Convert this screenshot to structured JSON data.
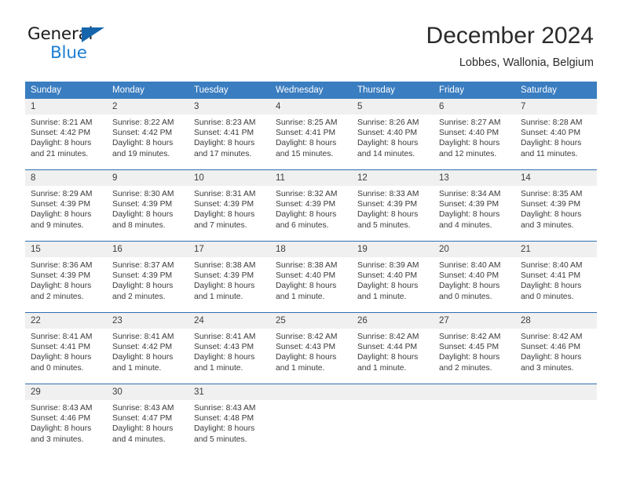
{
  "brand": {
    "name_part1": "General",
    "name_part2": "Blue",
    "triangle_color": "#1565ac",
    "blue_color": "#1b7fd4"
  },
  "header": {
    "title": "December 2024",
    "subtitle": "Lobbes, Wallonia, Belgium"
  },
  "theme": {
    "header_row_bg": "#3a7dc0",
    "daynum_bg": "#f0f0f0",
    "week_separator": "#2f6fb0"
  },
  "weekday_headers": [
    "Sunday",
    "Monday",
    "Tuesday",
    "Wednesday",
    "Thursday",
    "Friday",
    "Saturday"
  ],
  "weeks": [
    {
      "days": [
        {
          "num": "1",
          "sunrise": "Sunrise: 8:21 AM",
          "sunset": "Sunset: 4:42 PM",
          "daylight1": "Daylight: 8 hours",
          "daylight2": "and 21 minutes."
        },
        {
          "num": "2",
          "sunrise": "Sunrise: 8:22 AM",
          "sunset": "Sunset: 4:42 PM",
          "daylight1": "Daylight: 8 hours",
          "daylight2": "and 19 minutes."
        },
        {
          "num": "3",
          "sunrise": "Sunrise: 8:23 AM",
          "sunset": "Sunset: 4:41 PM",
          "daylight1": "Daylight: 8 hours",
          "daylight2": "and 17 minutes."
        },
        {
          "num": "4",
          "sunrise": "Sunrise: 8:25 AM",
          "sunset": "Sunset: 4:41 PM",
          "daylight1": "Daylight: 8 hours",
          "daylight2": "and 15 minutes."
        },
        {
          "num": "5",
          "sunrise": "Sunrise: 8:26 AM",
          "sunset": "Sunset: 4:40 PM",
          "daylight1": "Daylight: 8 hours",
          "daylight2": "and 14 minutes."
        },
        {
          "num": "6",
          "sunrise": "Sunrise: 8:27 AM",
          "sunset": "Sunset: 4:40 PM",
          "daylight1": "Daylight: 8 hours",
          "daylight2": "and 12 minutes."
        },
        {
          "num": "7",
          "sunrise": "Sunrise: 8:28 AM",
          "sunset": "Sunset: 4:40 PM",
          "daylight1": "Daylight: 8 hours",
          "daylight2": "and 11 minutes."
        }
      ]
    },
    {
      "days": [
        {
          "num": "8",
          "sunrise": "Sunrise: 8:29 AM",
          "sunset": "Sunset: 4:39 PM",
          "daylight1": "Daylight: 8 hours",
          "daylight2": "and 9 minutes."
        },
        {
          "num": "9",
          "sunrise": "Sunrise: 8:30 AM",
          "sunset": "Sunset: 4:39 PM",
          "daylight1": "Daylight: 8 hours",
          "daylight2": "and 8 minutes."
        },
        {
          "num": "10",
          "sunrise": "Sunrise: 8:31 AM",
          "sunset": "Sunset: 4:39 PM",
          "daylight1": "Daylight: 8 hours",
          "daylight2": "and 7 minutes."
        },
        {
          "num": "11",
          "sunrise": "Sunrise: 8:32 AM",
          "sunset": "Sunset: 4:39 PM",
          "daylight1": "Daylight: 8 hours",
          "daylight2": "and 6 minutes."
        },
        {
          "num": "12",
          "sunrise": "Sunrise: 8:33 AM",
          "sunset": "Sunset: 4:39 PM",
          "daylight1": "Daylight: 8 hours",
          "daylight2": "and 5 minutes."
        },
        {
          "num": "13",
          "sunrise": "Sunrise: 8:34 AM",
          "sunset": "Sunset: 4:39 PM",
          "daylight1": "Daylight: 8 hours",
          "daylight2": "and 4 minutes."
        },
        {
          "num": "14",
          "sunrise": "Sunrise: 8:35 AM",
          "sunset": "Sunset: 4:39 PM",
          "daylight1": "Daylight: 8 hours",
          "daylight2": "and 3 minutes."
        }
      ]
    },
    {
      "days": [
        {
          "num": "15",
          "sunrise": "Sunrise: 8:36 AM",
          "sunset": "Sunset: 4:39 PM",
          "daylight1": "Daylight: 8 hours",
          "daylight2": "and 2 minutes."
        },
        {
          "num": "16",
          "sunrise": "Sunrise: 8:37 AM",
          "sunset": "Sunset: 4:39 PM",
          "daylight1": "Daylight: 8 hours",
          "daylight2": "and 2 minutes."
        },
        {
          "num": "17",
          "sunrise": "Sunrise: 8:38 AM",
          "sunset": "Sunset: 4:39 PM",
          "daylight1": "Daylight: 8 hours",
          "daylight2": "and 1 minute."
        },
        {
          "num": "18",
          "sunrise": "Sunrise: 8:38 AM",
          "sunset": "Sunset: 4:40 PM",
          "daylight1": "Daylight: 8 hours",
          "daylight2": "and 1 minute."
        },
        {
          "num": "19",
          "sunrise": "Sunrise: 8:39 AM",
          "sunset": "Sunset: 4:40 PM",
          "daylight1": "Daylight: 8 hours",
          "daylight2": "and 1 minute."
        },
        {
          "num": "20",
          "sunrise": "Sunrise: 8:40 AM",
          "sunset": "Sunset: 4:40 PM",
          "daylight1": "Daylight: 8 hours",
          "daylight2": "and 0 minutes."
        },
        {
          "num": "21",
          "sunrise": "Sunrise: 8:40 AM",
          "sunset": "Sunset: 4:41 PM",
          "daylight1": "Daylight: 8 hours",
          "daylight2": "and 0 minutes."
        }
      ]
    },
    {
      "days": [
        {
          "num": "22",
          "sunrise": "Sunrise: 8:41 AM",
          "sunset": "Sunset: 4:41 PM",
          "daylight1": "Daylight: 8 hours",
          "daylight2": "and 0 minutes."
        },
        {
          "num": "23",
          "sunrise": "Sunrise: 8:41 AM",
          "sunset": "Sunset: 4:42 PM",
          "daylight1": "Daylight: 8 hours",
          "daylight2": "and 1 minute."
        },
        {
          "num": "24",
          "sunrise": "Sunrise: 8:41 AM",
          "sunset": "Sunset: 4:43 PM",
          "daylight1": "Daylight: 8 hours",
          "daylight2": "and 1 minute."
        },
        {
          "num": "25",
          "sunrise": "Sunrise: 8:42 AM",
          "sunset": "Sunset: 4:43 PM",
          "daylight1": "Daylight: 8 hours",
          "daylight2": "and 1 minute."
        },
        {
          "num": "26",
          "sunrise": "Sunrise: 8:42 AM",
          "sunset": "Sunset: 4:44 PM",
          "daylight1": "Daylight: 8 hours",
          "daylight2": "and 1 minute."
        },
        {
          "num": "27",
          "sunrise": "Sunrise: 8:42 AM",
          "sunset": "Sunset: 4:45 PM",
          "daylight1": "Daylight: 8 hours",
          "daylight2": "and 2 minutes."
        },
        {
          "num": "28",
          "sunrise": "Sunrise: 8:42 AM",
          "sunset": "Sunset: 4:46 PM",
          "daylight1": "Daylight: 8 hours",
          "daylight2": "and 3 minutes."
        }
      ]
    },
    {
      "days": [
        {
          "num": "29",
          "sunrise": "Sunrise: 8:43 AM",
          "sunset": "Sunset: 4:46 PM",
          "daylight1": "Daylight: 8 hours",
          "daylight2": "and 3 minutes."
        },
        {
          "num": "30",
          "sunrise": "Sunrise: 8:43 AM",
          "sunset": "Sunset: 4:47 PM",
          "daylight1": "Daylight: 8 hours",
          "daylight2": "and 4 minutes."
        },
        {
          "num": "31",
          "sunrise": "Sunrise: 8:43 AM",
          "sunset": "Sunset: 4:48 PM",
          "daylight1": "Daylight: 8 hours",
          "daylight2": "and 5 minutes."
        },
        {
          "num": "",
          "sunrise": "",
          "sunset": "",
          "daylight1": "",
          "daylight2": ""
        },
        {
          "num": "",
          "sunrise": "",
          "sunset": "",
          "daylight1": "",
          "daylight2": ""
        },
        {
          "num": "",
          "sunrise": "",
          "sunset": "",
          "daylight1": "",
          "daylight2": ""
        },
        {
          "num": "",
          "sunrise": "",
          "sunset": "",
          "daylight1": "",
          "daylight2": ""
        }
      ]
    }
  ]
}
